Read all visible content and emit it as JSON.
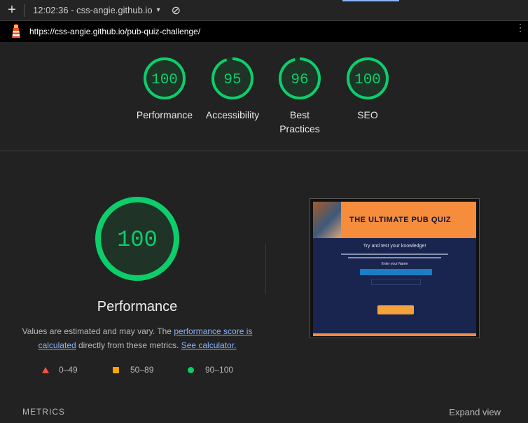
{
  "toolbar": {
    "new_tab_label": "+",
    "session_label": "12:02:36 - css-angie.github.io",
    "dropdown_glyph": "▾",
    "clear_glyph": "⊘"
  },
  "address": {
    "url": "https://css-angie.github.io/pub-quiz-challenge/",
    "menu_glyph": "⋮"
  },
  "scores": [
    {
      "value": "100",
      "label": "Performance",
      "score": 100,
      "color": "#0cce6b"
    },
    {
      "value": "95",
      "label": "Accessibility",
      "score": 95,
      "color": "#0cce6b"
    },
    {
      "value": "96",
      "label": "Best Practices",
      "score": 96,
      "color": "#0cce6b"
    },
    {
      "value": "100",
      "label": "SEO",
      "score": 100,
      "color": "#0cce6b"
    }
  ],
  "performance": {
    "score_text": "100",
    "score": 100,
    "title": "Performance",
    "desc_prefix": "Values are estimated and may vary. The ",
    "desc_link1": "performance score is calculated",
    "desc_middle": " directly from these metrics. ",
    "desc_link2": "See calculator."
  },
  "legend": {
    "fail": "0–49",
    "average": "50–89",
    "pass": "90–100",
    "fail_color": "#ff4e42",
    "average_color": "#ffa400",
    "pass_color": "#0cce6b"
  },
  "screenshot": {
    "title": "THE ULTIMATE PUB QUIZ",
    "subtitle": "Try and test your knowledge!",
    "input_label": "Enter your Name"
  },
  "metrics": {
    "heading": "METRICS",
    "expand": "Expand view"
  }
}
